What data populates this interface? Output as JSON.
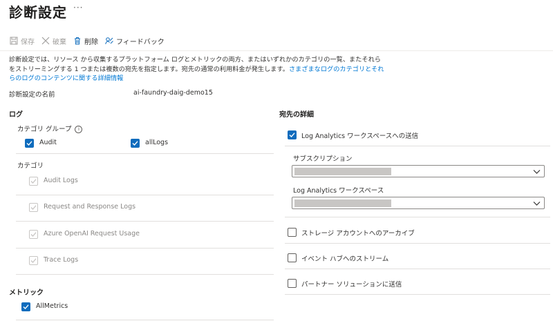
{
  "header": {
    "title": "診断設定",
    "more": "···"
  },
  "toolbar": {
    "save": "保存",
    "discard": "破棄",
    "delete": "削除",
    "feedback": "フィードバック"
  },
  "description": {
    "text": "診断設定では、リソース から収集するプラットフォーム ログとメトリックの両方、またはいずれかのカテゴリの一覧、またそれらをストリーミングする 1 つまたは複数の宛先を指定します。宛先の通常の利用料金が発生します。",
    "link": "さまざまなログのカテゴリとそれらのログのコンテンツに関する詳細情報"
  },
  "setting_name": {
    "label": "診断設定の名前",
    "value": "ai-faundry-daig-demo15"
  },
  "logs": {
    "heading": "ログ",
    "category_groups_label": "カテゴリ グループ",
    "info_icon": "info-icon",
    "groups": [
      {
        "label": "Audit",
        "checked": true
      },
      {
        "label": "allLogs",
        "checked": true
      }
    ],
    "categories_label": "カテゴリ",
    "categories": [
      {
        "label": "Audit Logs",
        "checked": true,
        "disabled": true
      },
      {
        "label": "Request and Response Logs",
        "checked": true,
        "disabled": true
      },
      {
        "label": "Azure OpenAI Request Usage",
        "checked": true,
        "disabled": true
      },
      {
        "label": "Trace Logs",
        "checked": true,
        "disabled": true
      }
    ]
  },
  "metrics": {
    "heading": "メトリック",
    "items": [
      {
        "label": "AllMetrics",
        "checked": true
      }
    ]
  },
  "destination": {
    "heading": "宛先の詳細",
    "log_analytics": {
      "label": "Log Analytics ワークスペースへの送信",
      "checked": true
    },
    "subscription_label": "サブスクリプション",
    "workspace_label": "Log Analytics ワークスペース",
    "storage": {
      "label": "ストレージ アカウントへのアーカイブ",
      "checked": false
    },
    "event_hub": {
      "label": "イベント ハブへのストリーム",
      "checked": false
    },
    "partner": {
      "label": "パートナー ソリューションに送信",
      "checked": false
    }
  },
  "colors": {
    "accent": "#0f6cbd",
    "link": "#0078d4",
    "disabled": "#a19f9d"
  }
}
